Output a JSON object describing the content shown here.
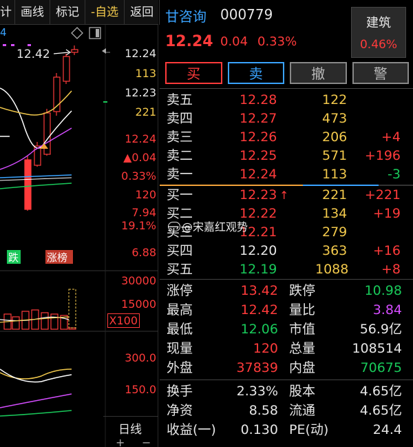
{
  "toolbar": {
    "items": [
      {
        "label": "计"
      },
      {
        "label": "画线"
      },
      {
        "label": "标记"
      },
      {
        "label": "-自选"
      },
      {
        "label": "返回"
      }
    ]
  },
  "chart": {
    "header_digit": "4",
    "max_label": "12.42",
    "right_axis": {
      "price_top": "12.24",
      "vol_113": "113",
      "price_2": "12.23",
      "vol_221": "221",
      "price_3": "12.24",
      "change": "▲0.04",
      "change_pct": "0.33%",
      "vol_120": "120",
      "low_1": "7.94",
      "pct_19": "19.1%",
      "low_2": "6.88"
    },
    "tags": {
      "fall": "跌",
      "limit": "涨榜"
    },
    "volume_axis": {
      "v1": "30000",
      "v2": "15000",
      "mult": "X100"
    },
    "indicator_axis": {
      "v1": "300.0",
      "v2": "150.0"
    },
    "bottom_tabs": {
      "label": "日线",
      "plus": "+",
      "minus": "−"
    },
    "colors": {
      "up": "#ff3b3b",
      "down": "#19c95a",
      "ma5": "#ffffff",
      "ma10": "#f2c94c",
      "ma20": "#d44dff"
    }
  },
  "quote": {
    "name": "甘咨询",
    "code": "000779",
    "price": "12.24",
    "change": "0.04",
    "change_pct": "0.33%",
    "sector": {
      "name": "建筑",
      "pct": "0.46%"
    },
    "actions": {
      "buy": "买",
      "sell": "卖",
      "cancel": "撤",
      "alert": "警"
    },
    "sell_book": [
      {
        "label": "卖五",
        "price": "12.28",
        "vol": "122",
        "delta": ""
      },
      {
        "label": "卖四",
        "price": "12.27",
        "vol": "473",
        "delta": ""
      },
      {
        "label": "卖三",
        "price": "12.26",
        "vol": "206",
        "delta": "+4"
      },
      {
        "label": "卖二",
        "price": "12.25",
        "vol": "571",
        "delta": "+196"
      },
      {
        "label": "卖一",
        "price": "12.24",
        "vol": "113",
        "delta": "-3"
      }
    ],
    "buy_book": [
      {
        "label": "买一",
        "price": "12.23",
        "vol": "221",
        "delta": "+221"
      },
      {
        "label": "买二",
        "price": "12.22",
        "vol": "134",
        "delta": "+19"
      },
      {
        "label": "买三",
        "price": "12.21",
        "vol": "279",
        "delta": ""
      },
      {
        "label": "买四",
        "price": "12.20",
        "vol": "363",
        "delta": "+16"
      },
      {
        "label": "买五",
        "price": "12.19",
        "vol": "1088",
        "delta": "+8"
      }
    ],
    "stats": [
      {
        "l1": "涨停",
        "v1": "13.42",
        "l2": "跌停",
        "v2": "10.98"
      },
      {
        "l1": "最高",
        "v1": "12.42",
        "l2": "量比",
        "v2": "3.84"
      },
      {
        "l1": "最低",
        "v1": "12.06",
        "l2": "市值",
        "v2": "56.9亿"
      },
      {
        "l1": "现量",
        "v1": "120",
        "l2": "总量",
        "v2": "108514"
      },
      {
        "l1": "外盘",
        "v1": "37839",
        "l2": "内盘",
        "v2": "70675"
      }
    ],
    "stats2": [
      {
        "l1": "换手",
        "v1": "2.33%",
        "l2": "股本",
        "v2": "4.65亿"
      },
      {
        "l1": "净资",
        "v1": "8.58",
        "l2": "流通",
        "v2": "4.65亿"
      },
      {
        "l1": "收益(一)",
        "v1": "0.130",
        "l2": "PE(动)",
        "v2": "24.4"
      }
    ]
  },
  "watermark": "@宋嘉红观势"
}
